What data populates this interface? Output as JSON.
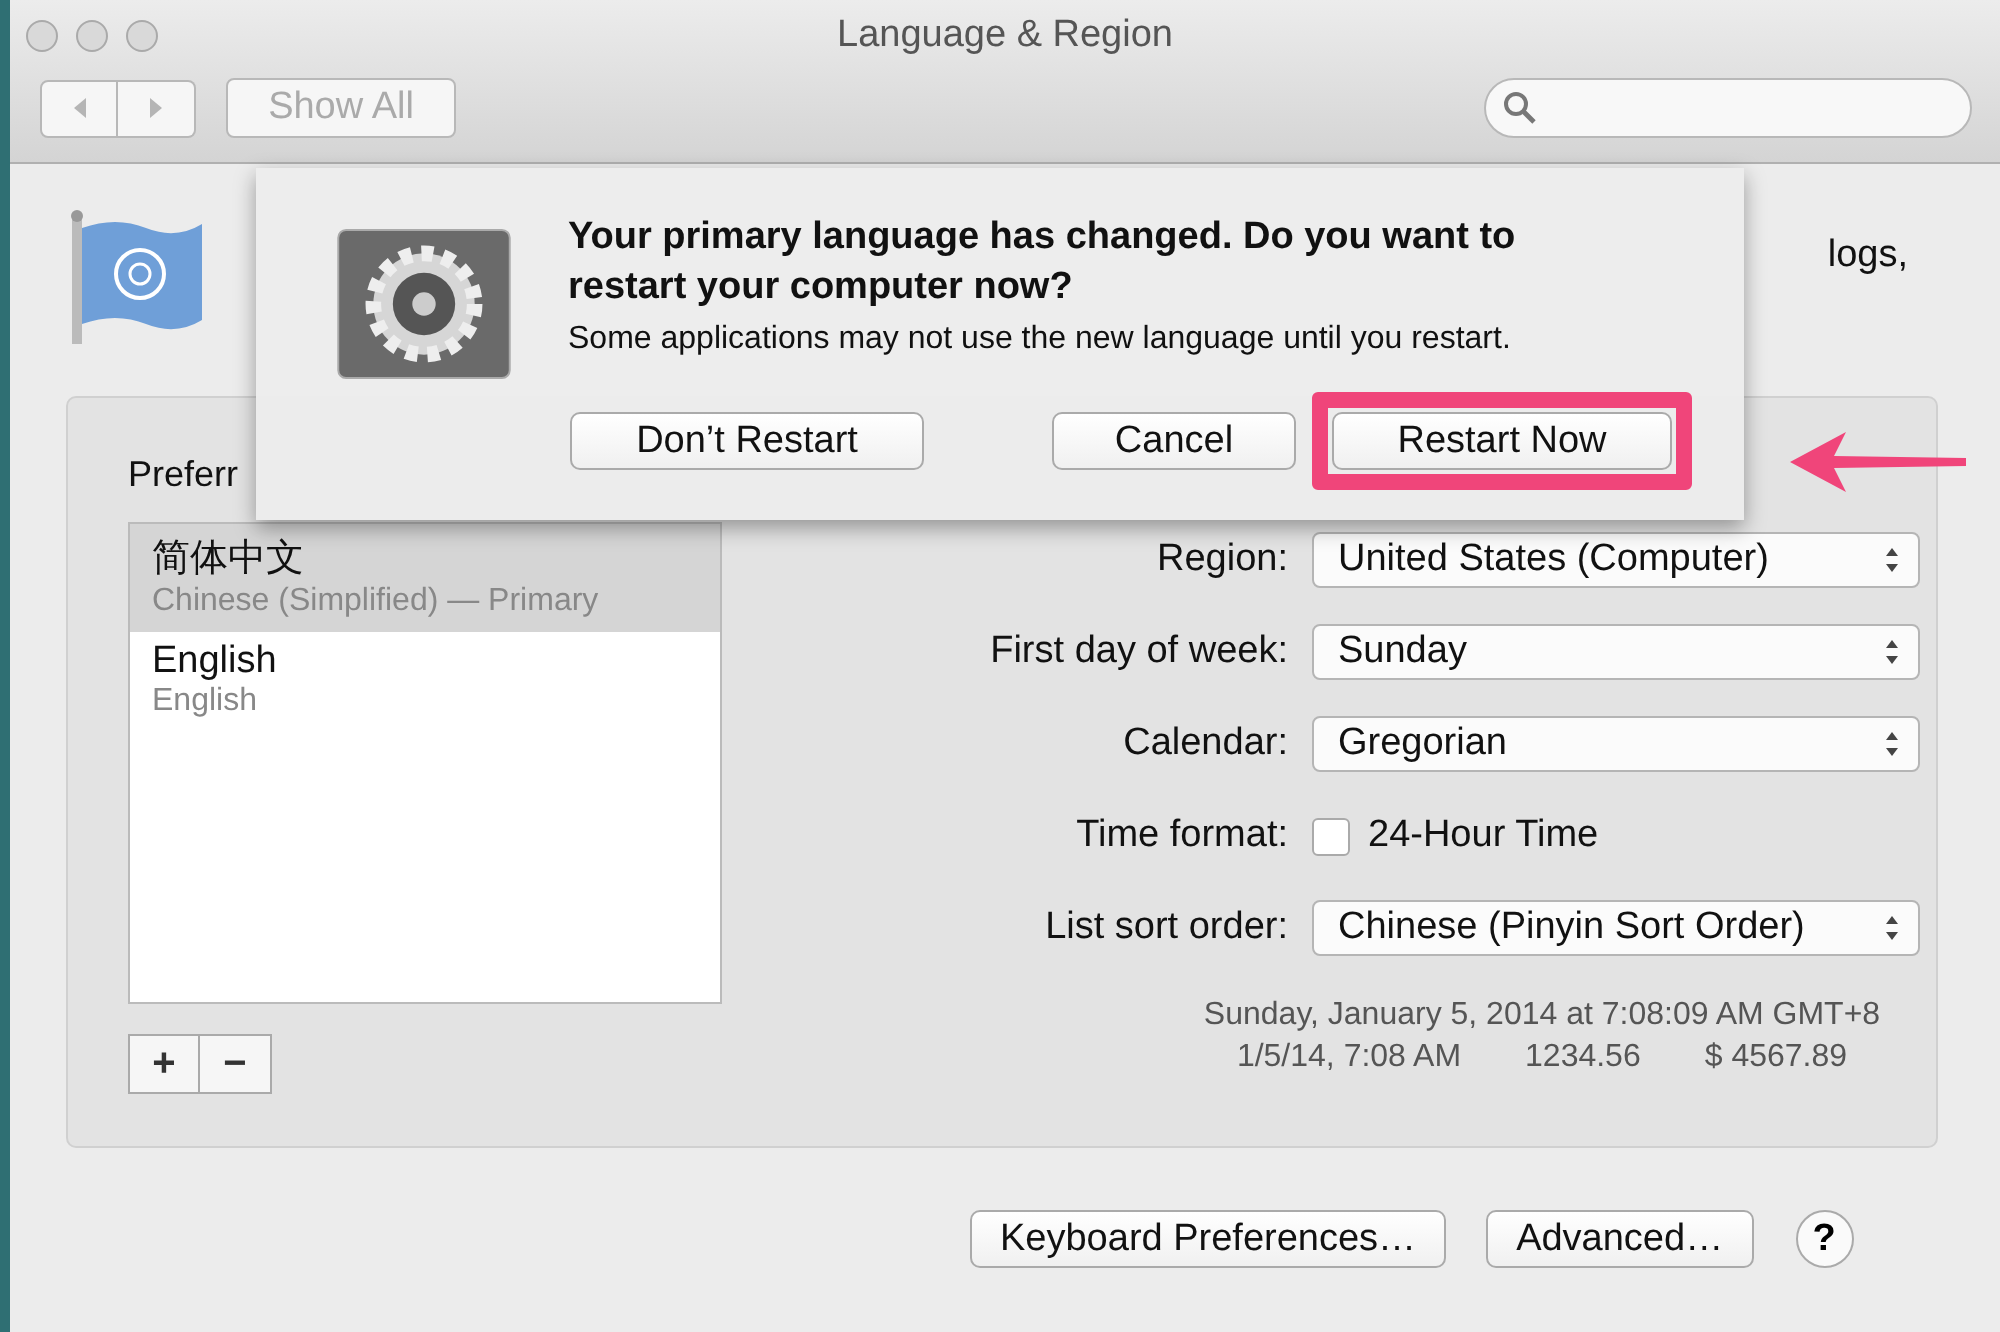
{
  "window": {
    "title": "Language & Region",
    "show_all": "Show All"
  },
  "description_fragment": "logs,",
  "languages": {
    "label": "Preferr",
    "items": [
      {
        "name": "简体中文",
        "detail": "Chinese (Simplified) — Primary",
        "selected": true
      },
      {
        "name": "English",
        "detail": "English",
        "selected": false
      }
    ],
    "add": "+",
    "remove": "−"
  },
  "settings": [
    {
      "kind": "select",
      "label": "Region:",
      "value": "United States (Computer)"
    },
    {
      "kind": "select",
      "label": "First day of week:",
      "value": "Sunday"
    },
    {
      "kind": "select",
      "label": "Calendar:",
      "value": "Gregorian"
    },
    {
      "kind": "checkbox",
      "label": "Time format:",
      "value": "24-Hour Time",
      "checked": false
    },
    {
      "kind": "select",
      "label": "List sort order:",
      "value": "Chinese (Pinyin Sort Order)"
    }
  ],
  "samples": {
    "long": "Sunday, January 5, 2014 at 7:08:09 AM GMT+8",
    "short": [
      "1/5/14, 7:08 AM",
      "1234.56",
      "$ 4567.89"
    ]
  },
  "buttons": {
    "keyboard": "Keyboard Preferences…",
    "advanced": "Advanced…",
    "help": "?"
  },
  "dialog": {
    "title": "Your primary language has changed. Do you want to restart your computer now?",
    "message": "Some applications may not use the new language until you restart.",
    "buttons": [
      {
        "label": "Don’t Restart",
        "highlighted": false
      },
      {
        "label": "Cancel",
        "highlighted": false
      },
      {
        "label": "Restart Now",
        "highlighted": true
      }
    ]
  }
}
